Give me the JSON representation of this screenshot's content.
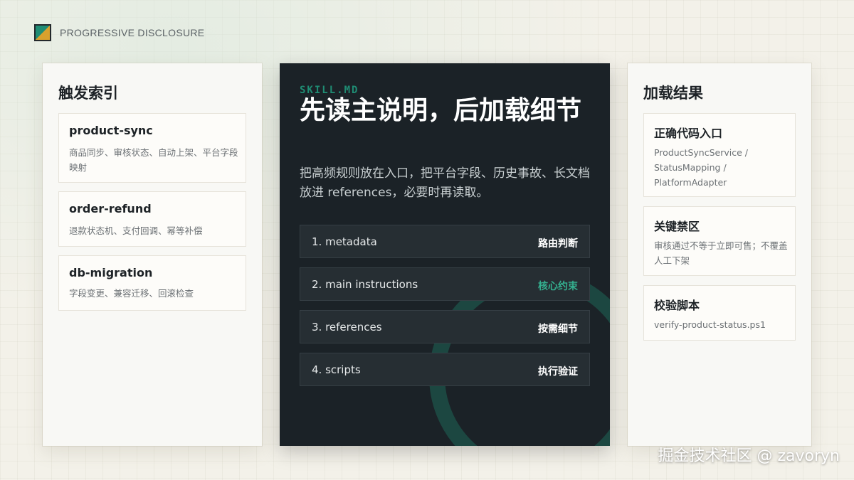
{
  "header": {
    "brand_label": "PROGRESSIVE DISCLOSURE"
  },
  "left_panel": {
    "title": "触发索引",
    "cards": [
      {
        "title": "product-sync",
        "desc": "商品同步、审核状态、自动上架、平台字段映射"
      },
      {
        "title": "order-refund",
        "desc": "退款状态机、支付回调、幂等补偿"
      },
      {
        "title": "db-migration",
        "desc": "字段变更、兼容迁移、回滚检查"
      }
    ]
  },
  "center_panel": {
    "eyebrow": "SKILL.MD",
    "headline": "先读主说明，后加载细节",
    "lead": "把高频规则放在入口，把平台字段、历史事故、长文档放进 references，必要时再读取。",
    "steps": [
      {
        "label": "1. metadata",
        "tag": "路由判断"
      },
      {
        "label": "2. main instructions",
        "tag": "核心约束"
      },
      {
        "label": "3. references",
        "tag": "按需细节"
      },
      {
        "label": "4. scripts",
        "tag": "执行验证"
      }
    ]
  },
  "right_panel": {
    "title": "加载结果",
    "cards": [
      {
        "title": "正确代码入口",
        "desc": "ProductSyncService / StatusMapping / PlatformAdapter"
      },
      {
        "title": "关键禁区",
        "desc": "审核通过不等于立即可售；不覆盖人工下架"
      },
      {
        "title": "校验脚本",
        "desc": "verify-product-status.ps1"
      }
    ]
  },
  "watermark": "掘金技术社区 @ zavoryn",
  "colors": {
    "accent": "#1f8d74",
    "dark_panel": "#1b2227",
    "page_bg": "#f3f1e9"
  }
}
